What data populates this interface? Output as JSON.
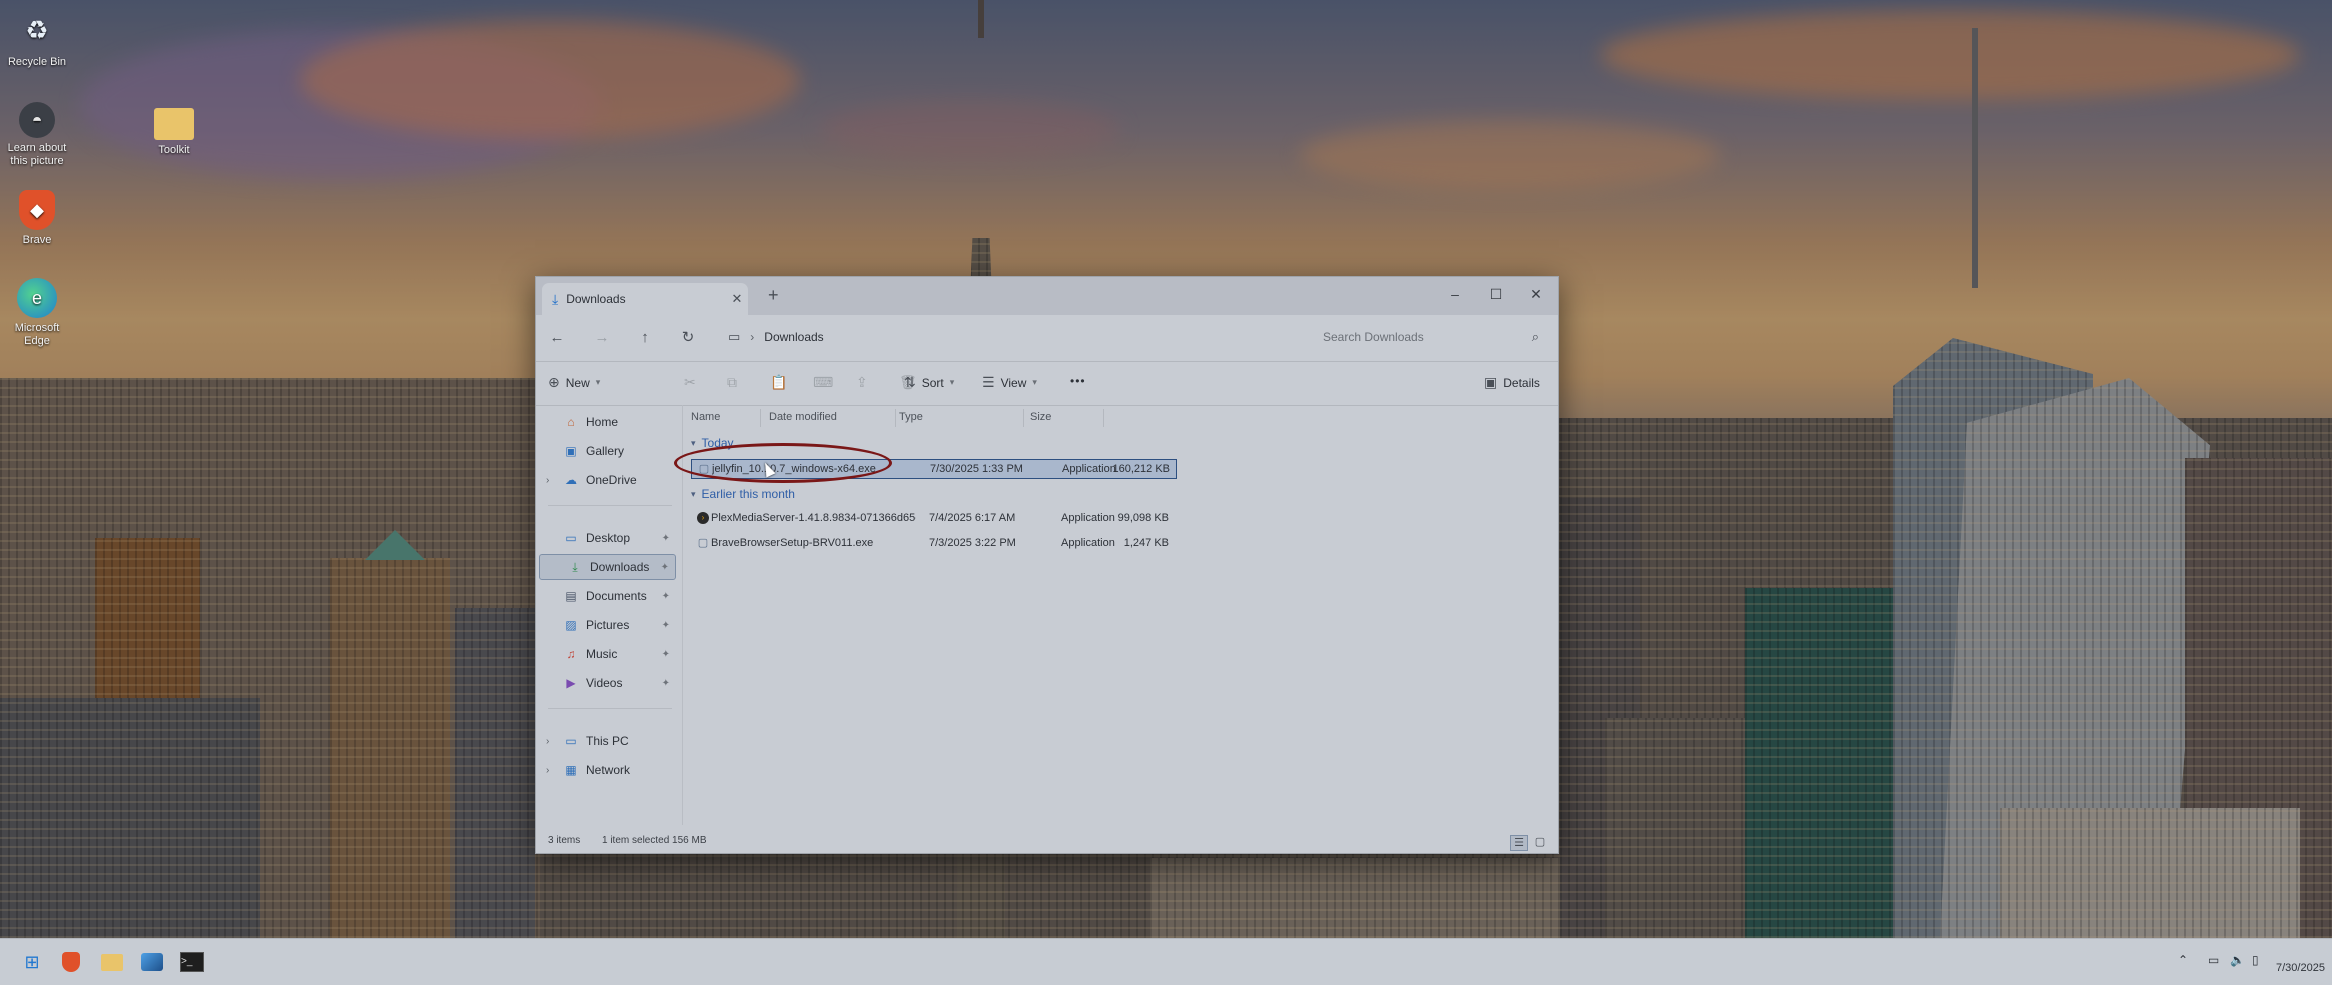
{
  "desktop": {
    "icons": [
      {
        "label": "Recycle Bin",
        "icon": "recycle-bin-icon"
      },
      {
        "label": "Learn about this picture",
        "icon": "learn-about-picture-icon"
      },
      {
        "label": "Brave",
        "icon": "brave-browser-icon"
      },
      {
        "label": "Microsoft Edge",
        "icon": "edge-browser-icon"
      },
      {
        "label": "Toolkit",
        "icon": "folder-icon"
      }
    ]
  },
  "window": {
    "tab_title": "Downloads",
    "new_tab_glyph": "+",
    "controls": {
      "minimize": "–",
      "maximize": "☐",
      "close": "✕"
    },
    "breadcrumb": [
      "Downloads"
    ],
    "search_placeholder": "Search Downloads",
    "commands": {
      "new": "New",
      "sort": "Sort",
      "view": "View",
      "more": "•••",
      "details": "Details"
    },
    "nav": {
      "home": "Home",
      "gallery": "Gallery",
      "onedrive": "OneDrive",
      "desktop": "Desktop",
      "downloads": "Downloads",
      "documents": "Documents",
      "pictures": "Pictures",
      "music": "Music",
      "videos": "Videos",
      "thispc": "This PC",
      "network": "Network"
    },
    "columns": {
      "name": "Name",
      "date": "Date modified",
      "type": "Type",
      "size": "Size"
    },
    "groups": {
      "today": "Today",
      "earlier": "Earlier this month"
    },
    "files": [
      {
        "name": "jellyfin_10.10.7_windows-x64.exe",
        "date": "7/30/2025 1:33 PM",
        "type": "Application",
        "size": "160,212 KB",
        "selected": true
      },
      {
        "name": "PlexMediaServer-1.41.8.9834-071366d65-...",
        "date": "7/4/2025 6:17 AM",
        "type": "Application",
        "size": "99,098 KB",
        "selected": false
      },
      {
        "name": "BraveBrowserSetup-BRV011.exe",
        "date": "7/3/2025 3:22 PM",
        "type": "Application",
        "size": "1,247 KB",
        "selected": false
      }
    ],
    "status": {
      "count": "3 items",
      "selection": "1 item selected  156 MB"
    }
  },
  "taskbar": {
    "apps": [
      "start-icon",
      "brave-browser-icon",
      "file-explorer-icon",
      "photos-icon",
      "terminal-icon"
    ],
    "date": "7/30/2025"
  },
  "colors": {
    "selection": "#a9b7cc",
    "accent": "#1f6fc9",
    "annotation": "#7a1717"
  }
}
